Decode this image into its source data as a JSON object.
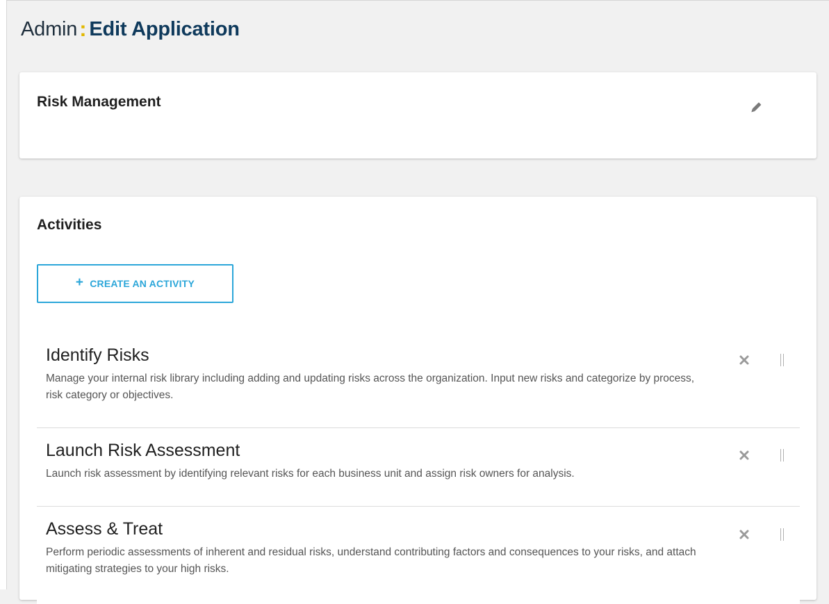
{
  "header": {
    "title_prefix": "Admin",
    "title_separator": ":",
    "title_main": "Edit Application"
  },
  "application": {
    "name": "Risk Management",
    "edit_icon": "pencil-icon"
  },
  "activities": {
    "section_title": "Activities",
    "create_button": {
      "icon": "+",
      "label": "CREATE AN ACTIVITY"
    },
    "items": [
      {
        "title": "Identify Risks",
        "description": "Manage your internal risk library including adding and updating risks across the organization. Input new risks and categorize by process, risk category or objectives."
      },
      {
        "title": "Launch Risk Assessment",
        "description": "Launch risk assessment by identifying relevant risks for each business unit and assign risk owners for analysis."
      },
      {
        "title": "Assess & Treat",
        "description": "Perform periodic assessments of inherent and residual risks, understand contributing factors and consequences to your risks, and attach mitigating strategies to your high risks."
      }
    ]
  },
  "colors": {
    "accent": "#2ba6d9",
    "title_blue": "#0f3a5c",
    "colon_yellow": "#e2b800",
    "icon_gray": "#9a9a9a"
  }
}
